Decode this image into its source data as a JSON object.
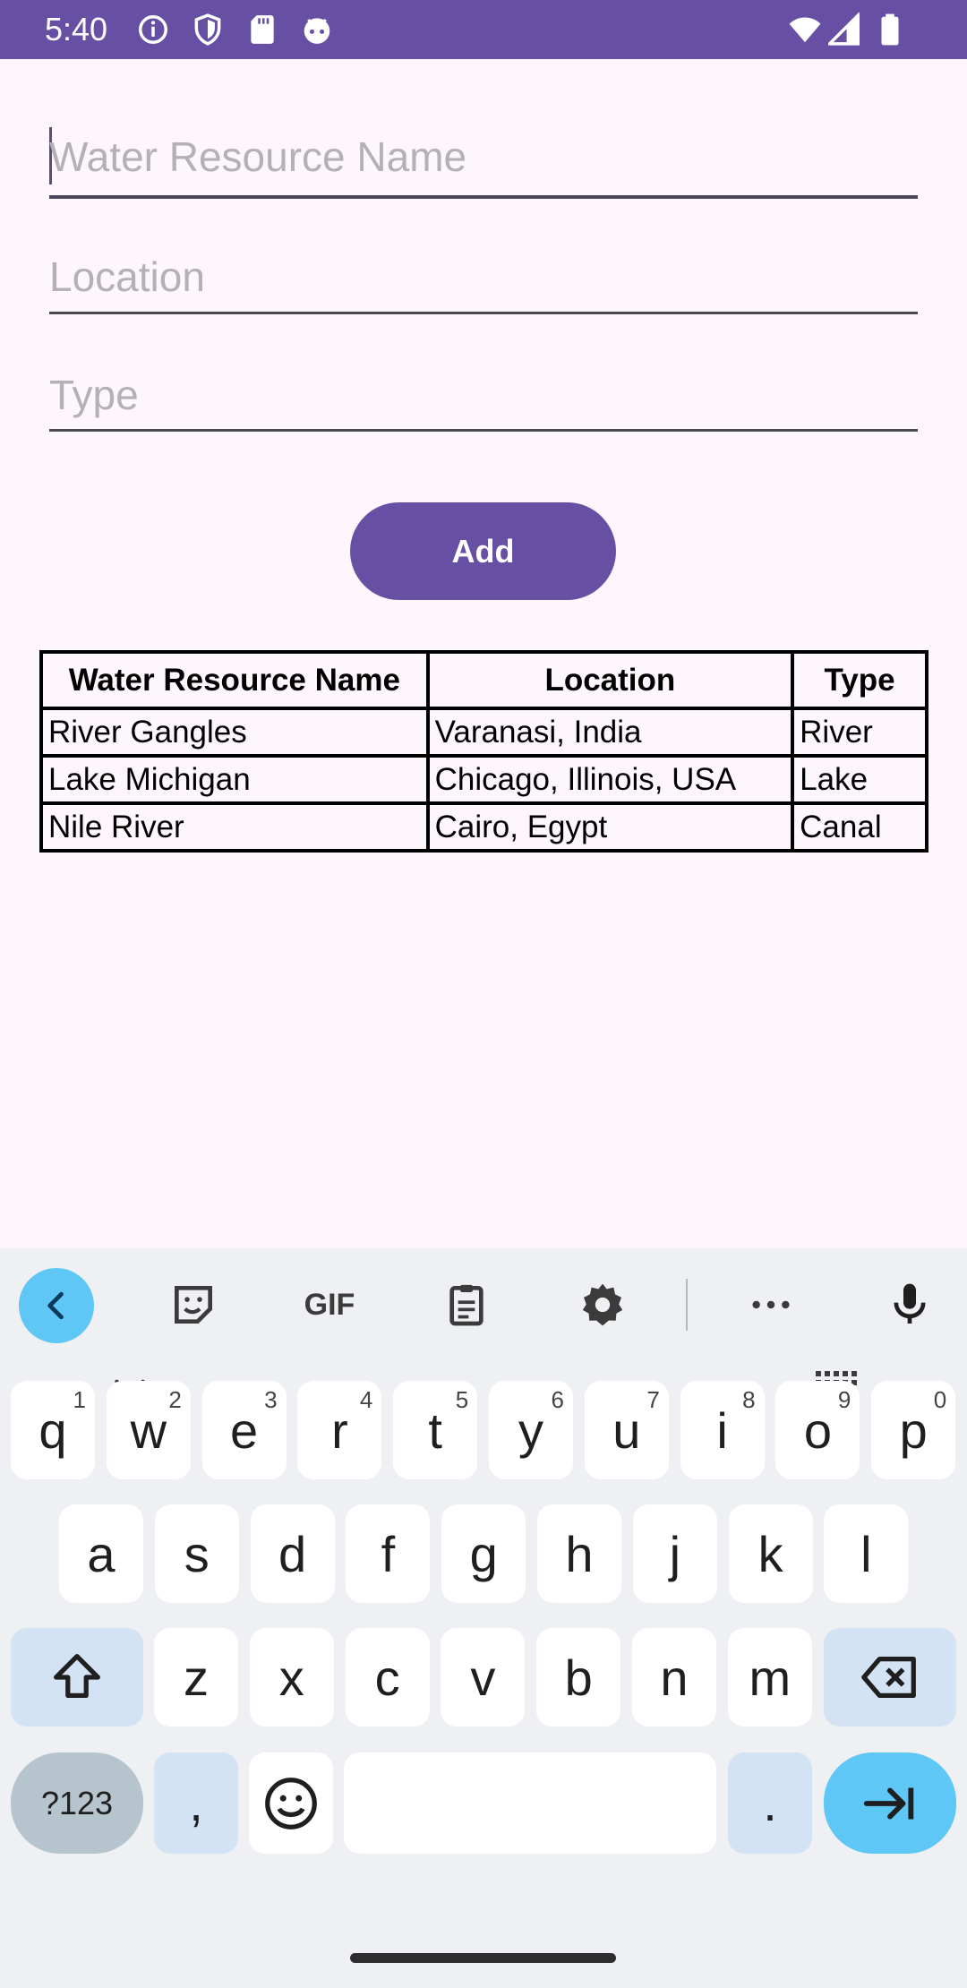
{
  "status_bar": {
    "time": "5:40",
    "left_icons": [
      "info-icon",
      "shield-icon",
      "sd-card-icon",
      "android-icon"
    ],
    "right_icons": [
      "wifi-icon",
      "signal-icon",
      "battery-icon"
    ],
    "color": "#6750a4"
  },
  "form": {
    "name_placeholder": "Water Resource Name",
    "location_placeholder": "Location",
    "type_placeholder": "Type",
    "add_label": "Add"
  },
  "table": {
    "headers": [
      "Water Resource Name",
      "Location",
      "Type"
    ],
    "rows": [
      [
        "River Gangles",
        "Varanasi, India",
        "River"
      ],
      [
        "Lake Michigan",
        "Chicago, Illinois, USA",
        "Lake"
      ],
      [
        "Nile River",
        "Cairo, Egypt",
        "Canal"
      ]
    ]
  },
  "keyboard": {
    "toolbar": [
      "back-icon",
      "sticker-icon",
      "gif-icon",
      "clipboard-icon",
      "settings-icon",
      "more-icon",
      "mic-icon"
    ],
    "gif_label": "GIF",
    "row1": [
      {
        "k": "q",
        "h": "1"
      },
      {
        "k": "w",
        "h": "2"
      },
      {
        "k": "e",
        "h": "3"
      },
      {
        "k": "r",
        "h": "4"
      },
      {
        "k": "t",
        "h": "5"
      },
      {
        "k": "y",
        "h": "6"
      },
      {
        "k": "u",
        "h": "7"
      },
      {
        "k": "i",
        "h": "8"
      },
      {
        "k": "o",
        "h": "9"
      },
      {
        "k": "p",
        "h": "0"
      }
    ],
    "row2": [
      "a",
      "s",
      "d",
      "f",
      "g",
      "h",
      "j",
      "k",
      "l"
    ],
    "row3": [
      "z",
      "x",
      "c",
      "v",
      "b",
      "n",
      "m"
    ],
    "sym_label": "?123",
    "comma": ",",
    "period": "."
  }
}
